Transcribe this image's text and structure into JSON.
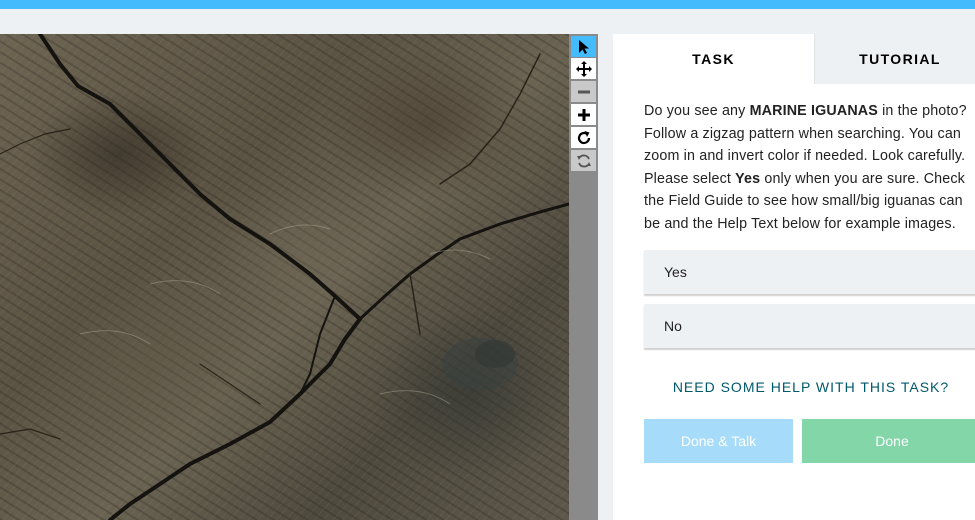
{
  "colors": {
    "accent_blue": "#43bbfd",
    "talk_button": "#a6dcf9",
    "done_button": "#82d6a7",
    "help_link": "#00596a"
  },
  "viewer": {
    "tools": [
      {
        "name": "pointer-icon",
        "state": "active"
      },
      {
        "name": "move-icon",
        "state": "normal"
      },
      {
        "name": "zoom-out-icon",
        "state": "disabled"
      },
      {
        "name": "zoom-in-icon",
        "state": "normal"
      },
      {
        "name": "rotate-icon",
        "state": "normal"
      },
      {
        "name": "reset-icon",
        "state": "disabled"
      }
    ]
  },
  "tabs": {
    "task": "TASK",
    "tutorial": "TUTORIAL"
  },
  "instructions": {
    "l1_a": "Do you see any ",
    "l1_b": "MARINE IGUANAS",
    "l1_c": " in the photo?",
    "l2": "Follow a zigzag pattern when searching. You can",
    "l3": "zoom in and invert color if needed. Look carefully.",
    "l4_a": "Please select ",
    "l4_b": "Yes",
    "l4_c": " only when you are sure. Check",
    "l5": "the Field Guide to see how small/big iguanas can",
    "l6": "be and the Help Text below for example images."
  },
  "answers": {
    "yes": "Yes",
    "no": "No"
  },
  "help_link": "NEED SOME HELP WITH THIS TASK?",
  "buttons": {
    "done_talk": "Done & Talk",
    "done": "Done"
  }
}
